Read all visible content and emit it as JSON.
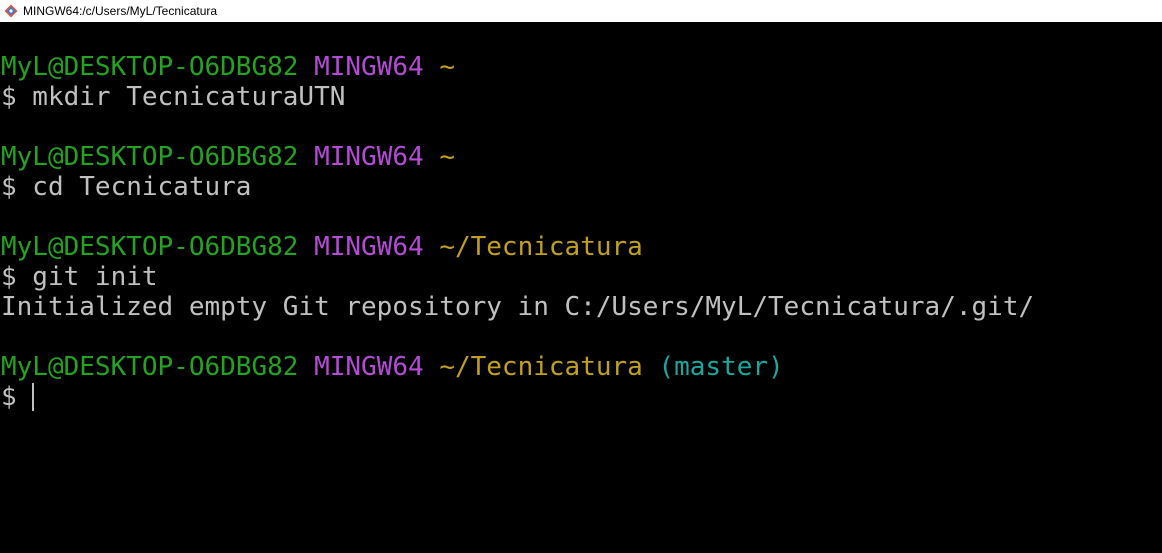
{
  "window": {
    "title": "MINGW64:/c/Users/MyL/Tecnicatura",
    "icon": "git-bash-icon"
  },
  "colors": {
    "user": "#23a31f",
    "host": "#b44ad6",
    "path": "#c2a01d",
    "branch": "#19a8a0",
    "text": "#c0c0c0",
    "background": "#000000"
  },
  "terminal": {
    "blocks": [
      {
        "prompt": {
          "user": "MyL@DESKTOP-O6DBG82",
          "host": "MINGW64",
          "path": "~",
          "branch": ""
        },
        "command": "$ mkdir TecnicaturaUTN",
        "output": ""
      },
      {
        "prompt": {
          "user": "MyL@DESKTOP-O6DBG82",
          "host": "MINGW64",
          "path": "~",
          "branch": ""
        },
        "command": "$ cd Tecnicatura",
        "output": ""
      },
      {
        "prompt": {
          "user": "MyL@DESKTOP-O6DBG82",
          "host": "MINGW64",
          "path": "~/Tecnicatura",
          "branch": ""
        },
        "command": "$ git init",
        "output": "Initialized empty Git repository in C:/Users/MyL/Tecnicatura/.git/"
      },
      {
        "prompt": {
          "user": "MyL@DESKTOP-O6DBG82",
          "host": "MINGW64",
          "path": "~/Tecnicatura",
          "branch": "(master)"
        },
        "command": "$ ",
        "output": ""
      }
    ]
  }
}
